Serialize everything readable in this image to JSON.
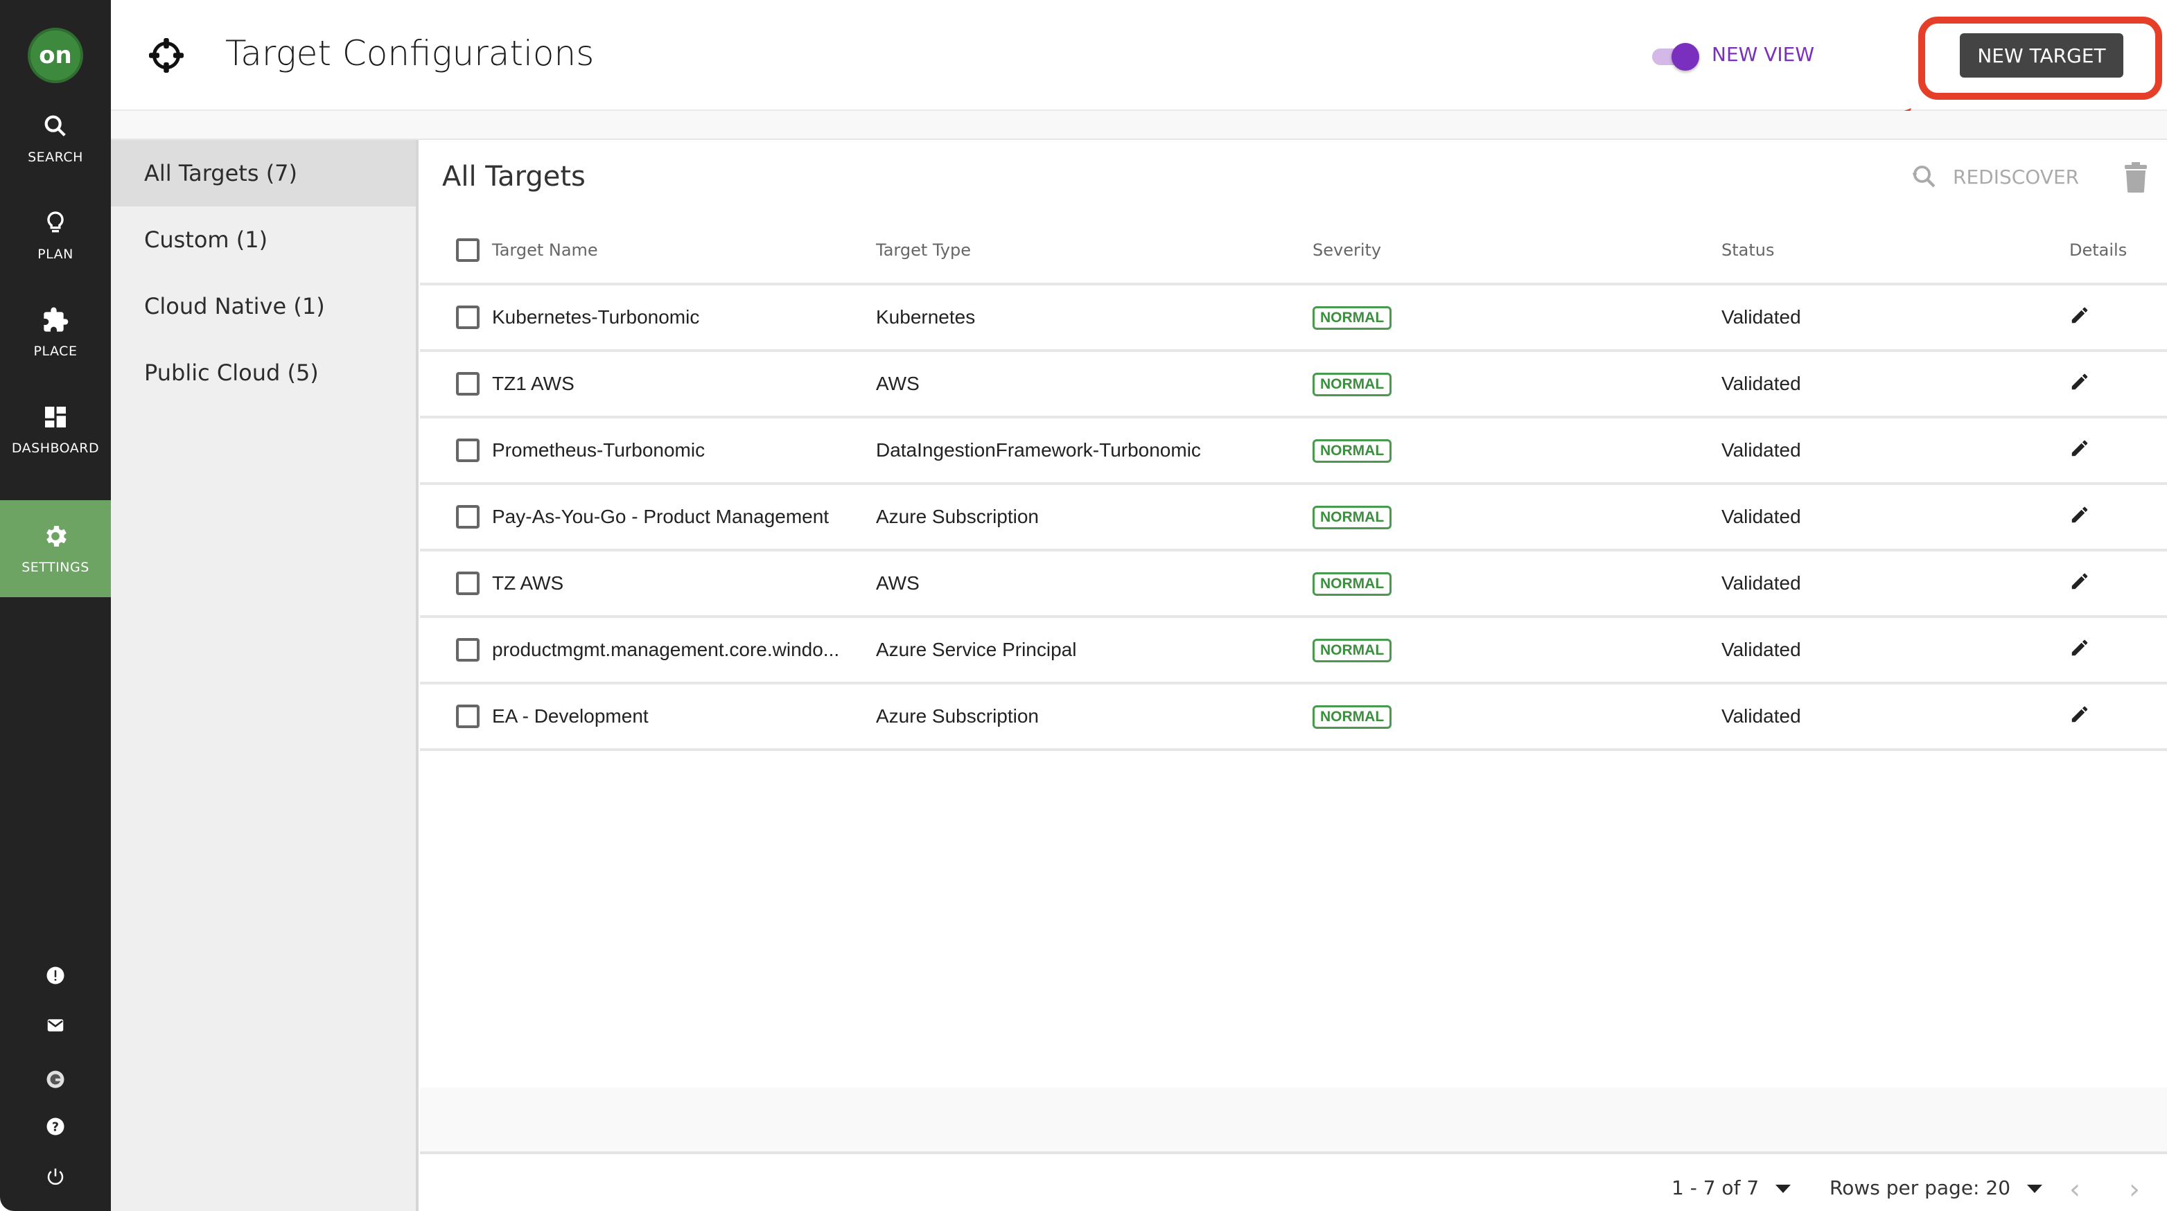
{
  "rail": {
    "logo_text": "on",
    "items": [
      {
        "label": "SEARCH",
        "icon": "search-icon"
      },
      {
        "label": "PLAN",
        "icon": "lightbulb-icon"
      },
      {
        "label": "PLACE",
        "icon": "puzzle-icon"
      },
      {
        "label": "DASHBOARD",
        "icon": "dashboard-icon"
      },
      {
        "label": "SETTINGS",
        "icon": "gear-icon",
        "active": true
      }
    ],
    "bottom_icons": [
      "alert-icon",
      "mail-icon",
      "g-icon",
      "help-icon",
      "power-icon"
    ],
    "active_color": "#6da463"
  },
  "header": {
    "title": "Target Configurations",
    "title_icon": "crosshair-icon",
    "toggle_label": "NEW VIEW",
    "toggle_on": true,
    "new_target_label": "NEW TARGET",
    "accent_color": "#7b2fbe"
  },
  "categories": [
    {
      "label": "All Targets (7)",
      "active": true
    },
    {
      "label": "Custom (1)"
    },
    {
      "label": "Cloud Native (1)"
    },
    {
      "label": "Public Cloud (5)"
    }
  ],
  "main": {
    "title": "All Targets",
    "rediscover_label": "REDISCOVER",
    "columns": [
      "Target Name",
      "Target Type",
      "Severity",
      "Status",
      "Details"
    ],
    "rows": [
      {
        "name": "Kubernetes-Turbonomic",
        "type": "Kubernetes",
        "severity": "NORMAL",
        "status": "Validated"
      },
      {
        "name": "TZ1 AWS",
        "type": "AWS",
        "severity": "NORMAL",
        "status": "Validated"
      },
      {
        "name": "Prometheus-Turbonomic",
        "type": "DataIngestionFramework-Turbonomic",
        "severity": "NORMAL",
        "status": "Validated"
      },
      {
        "name": "Pay-As-You-Go - Product Management",
        "type": "Azure Subscription",
        "severity": "NORMAL",
        "status": "Validated"
      },
      {
        "name": "TZ AWS",
        "type": "AWS",
        "severity": "NORMAL",
        "status": "Validated"
      },
      {
        "name": "productmgmt.management.core.windo...",
        "type": "Azure Service Principal",
        "severity": "NORMAL",
        "status": "Validated"
      },
      {
        "name": "EA - Development",
        "type": "Azure Subscription",
        "severity": "NORMAL",
        "status": "Validated"
      }
    ],
    "severity_color": "#3c8f3f"
  },
  "pager": {
    "range": "1 - 7 of 7",
    "rows_per_page": "Rows per page: 20",
    "prev": "‹",
    "next": "›"
  },
  "annotation_color": "#e53f2a"
}
